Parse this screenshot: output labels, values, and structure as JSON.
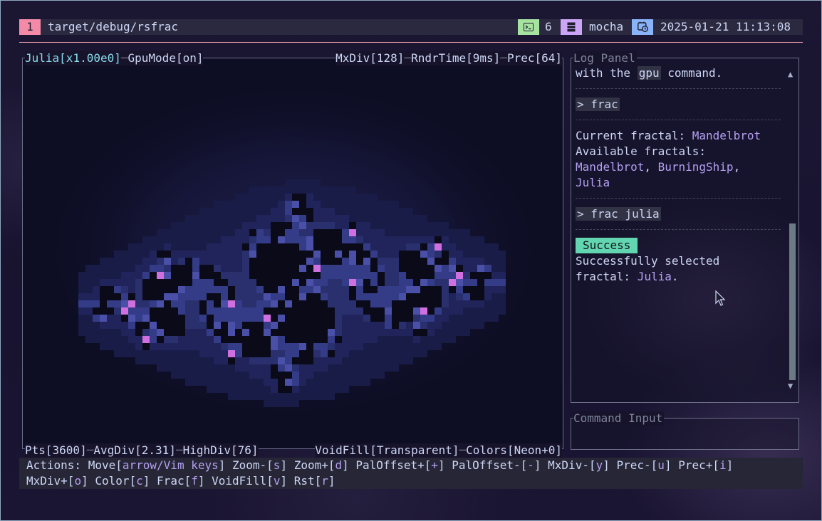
{
  "topbar": {
    "workspace": "1",
    "path": "target/debug/rsfrac",
    "terminal_icon": "terminal-icon",
    "count": "6",
    "server_icon": "server-icon",
    "theme": "mocha",
    "calendar_icon": "calendar-clock-icon",
    "datetime": "2025-01-21 11:13:08"
  },
  "render": {
    "fractal": "Julia",
    "zoom": "[x1.00e0]",
    "gpu_mode": "GpuMode[on]",
    "max_div": "MxDiv[128]",
    "render_time": "RndrTime[9ms]",
    "precision": "Prec[64]",
    "points": "Pts[3600]",
    "avg_div": "AvgDiv[2.31]",
    "high_div": "HighDiv[76]",
    "void_fill": "VoidFill[Transparent]",
    "colors": "Colors[Neon+0]"
  },
  "log": {
    "title": "Log Panel",
    "l1_pre": "with the ",
    "l1_cmd": "gpu",
    "l1_post": " command.",
    "cmd1": "> frac",
    "current_label": "Current fractal: ",
    "current_value": "Mandelbrot",
    "available_label": "Available fractals:",
    "opt1": "Mandelbrot",
    "comma1": ", ",
    "opt2": "BurningShip",
    "comma2": ",",
    "opt3": "Julia",
    "cmd2": "> frac julia",
    "success": "Success",
    "msg1": "Successfully selected",
    "msg2_pre": "fractal: ",
    "msg2_val": "Julia",
    "msg2_post": "."
  },
  "command_input": {
    "title": "Command Input",
    "value": ""
  },
  "actions": {
    "label": "Actions:",
    "items": [
      {
        "name": "Move",
        "key": "arrow/Vim keys"
      },
      {
        "name": "Zoom-",
        "key": "s"
      },
      {
        "name": "Zoom+",
        "key": "d"
      },
      {
        "name": "PalOffset+",
        "key": "+"
      },
      {
        "name": "PalOffset-",
        "key": "-"
      },
      {
        "name": "MxDiv-",
        "key": "y"
      },
      {
        "name": "Prec-",
        "key": "u"
      },
      {
        "name": "Prec+",
        "key": "i"
      },
      {
        "name": "MxDiv+",
        "key": "o"
      },
      {
        "name": "Color",
        "key": "c"
      },
      {
        "name": "Frac",
        "key": "f"
      },
      {
        "name": "VoidFill",
        "key": "v"
      },
      {
        "name": "Rst",
        "key": "r"
      }
    ]
  },
  "colors": {
    "workspace": "#f38ba8",
    "terminal": "#a6e3a1",
    "server": "#cba6f7",
    "calendar": "#89b4fa",
    "success": "#62d6b0",
    "accent": "#b4a0f0",
    "border": "#6c7086"
  }
}
